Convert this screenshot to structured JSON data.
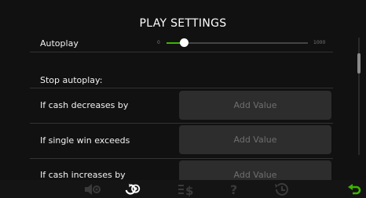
{
  "header": {
    "title": "PLAY SETTINGS"
  },
  "autoplay": {
    "label": "Autoplay",
    "min": "0",
    "max": "1000",
    "value_fraction": 0.12
  },
  "stop_autoplay": {
    "heading": "Stop autoplay:",
    "rows": [
      {
        "label": "If cash decreases by",
        "value_placeholder": "Add Value"
      },
      {
        "label": "If single win exceeds",
        "value_placeholder": "Add Value"
      },
      {
        "label": "If cash increases by",
        "value_placeholder": "Add Value"
      }
    ]
  },
  "toolbar": {
    "items": [
      {
        "icon": "sound-settings-icon"
      },
      {
        "icon": "game-settings-icon",
        "active": true
      },
      {
        "icon": "paytable-icon"
      },
      {
        "icon": "help-icon"
      },
      {
        "icon": "history-icon"
      },
      {
        "icon": "back-arrow-icon"
      }
    ]
  },
  "colors": {
    "accent": "#3fb400",
    "background": "#111111",
    "field": "#2d2d2d"
  }
}
